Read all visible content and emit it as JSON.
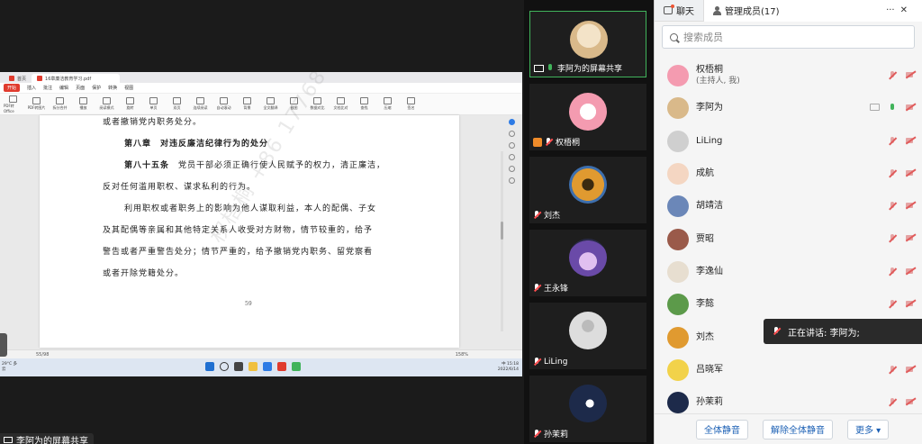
{
  "shared_screen": {
    "label": "李阿为的屏幕共享",
    "wps": {
      "tab_home": "首页",
      "tab_file": "16章廉洁教育学习.pdf",
      "menu": [
        "开始",
        "插入",
        "批注",
        "编辑",
        "页面",
        "保护",
        "转换",
        "视图"
      ],
      "tools": [
        "PDF转Office",
        "PDF转图片",
        "拆分合并",
        "播放",
        "阅读模式",
        "旋转",
        "单页",
        "双页",
        "连续阅读",
        "自动滚动",
        "背景",
        "全文翻译",
        "截图",
        "数据对比",
        "文档比对",
        "查找",
        "压缩",
        "签名"
      ],
      "page_number": "59",
      "status_page": "55/98",
      "status_zoom": "158%"
    },
    "document": {
      "line_prev": "或者撤销党内职务处分。",
      "chapter": "第八章　对违反廉洁纪律行为的处分",
      "article_label": "第八十五条",
      "article_text_1": "党员干部必须正确行使人民赋予的权力，清正廉洁，",
      "article_text_2": "反对任何滥用职权、谋求私利的行为。",
      "para_1": "利用职权或者职务上的影响为他人谋取利益，本人的配偶、子女",
      "para_2": "及其配偶等亲属和其他特定关系人收受对方财物，情节较重的，给予",
      "para_3": "警告或者严重警告处分；情节严重的，给予撤销党内职务、留党察看",
      "para_4": "或者开除党籍处分。",
      "watermark": "权梧桐 +86 17768095"
    },
    "taskbar": {
      "weather": "29°C 多云",
      "time": "15:18",
      "date": "2022/6/14",
      "ime": "中"
    }
  },
  "tiles": [
    {
      "name": "李阿为的屏幕共享",
      "mic": "on",
      "kind": "share"
    },
    {
      "name": "权梧桐",
      "mic": "off",
      "kind": "host"
    },
    {
      "name": "刘杰",
      "mic": "off",
      "kind": "normal"
    },
    {
      "name": "王永锋",
      "mic": "off",
      "kind": "normal"
    },
    {
      "name": "LiLing",
      "mic": "off",
      "kind": "normal"
    },
    {
      "name": "孙茉莉",
      "mic": "off",
      "kind": "normal"
    }
  ],
  "panel": {
    "tab_chat": "聊天",
    "tab_members": "管理成员(17)",
    "more": "···",
    "close": "✕",
    "search_placeholder": "搜索成员",
    "members": [
      {
        "name": "权梧桐",
        "sub": "(主持人, 我)",
        "avatar_color": "#f49bb0",
        "mic": "off"
      },
      {
        "name": "李阿为",
        "sub": "",
        "avatar_color": "#d9b98a",
        "mic": "on",
        "sharing": true
      },
      {
        "name": "LiLing",
        "sub": "",
        "avatar_color": "#cfcfcf",
        "mic": "off"
      },
      {
        "name": "成航",
        "sub": "",
        "avatar_color": "#f4d6c2",
        "mic": "off"
      },
      {
        "name": "胡靖洁",
        "sub": "",
        "avatar_color": "#6b87b8",
        "mic": "off"
      },
      {
        "name": "贾昭",
        "sub": "",
        "avatar_color": "#9a5a4a",
        "mic": "off"
      },
      {
        "name": "李逸仙",
        "sub": "",
        "avatar_color": "#e7ded0",
        "mic": "off"
      },
      {
        "name": "李懿",
        "sub": "",
        "avatar_color": "#5c9a4a",
        "mic": "off"
      },
      {
        "name": "刘杰",
        "sub": "",
        "avatar_color": "#e09a30",
        "mic": "off"
      },
      {
        "name": "吕晓军",
        "sub": "",
        "avatar_color": "#f2d24a",
        "mic": "off"
      },
      {
        "name": "孙茉莉",
        "sub": "",
        "avatar_color": "#1d2a4a",
        "mic": "off"
      }
    ],
    "btn_mute_all": "全体静音",
    "btn_unmute_all": "解除全体静音",
    "btn_more": "更多 ▾"
  },
  "speaking_toast": "正在讲话: 李阿为;"
}
